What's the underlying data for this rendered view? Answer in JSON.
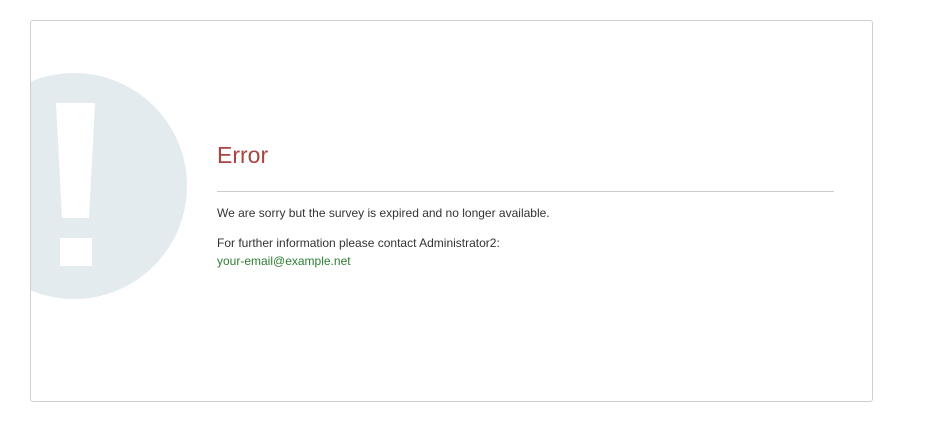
{
  "colors": {
    "title": "#a94442",
    "link": "#2e7d32",
    "graphic_circle": "#e3ebef",
    "graphic_mark": "#ffffff"
  },
  "error": {
    "icon": "exclamation-icon",
    "title": "Error",
    "message": "We are sorry but the survey is expired and no longer available.",
    "contact_prefix": "For further information please contact Administrator2:",
    "contact_email": "your-email@example.net"
  }
}
